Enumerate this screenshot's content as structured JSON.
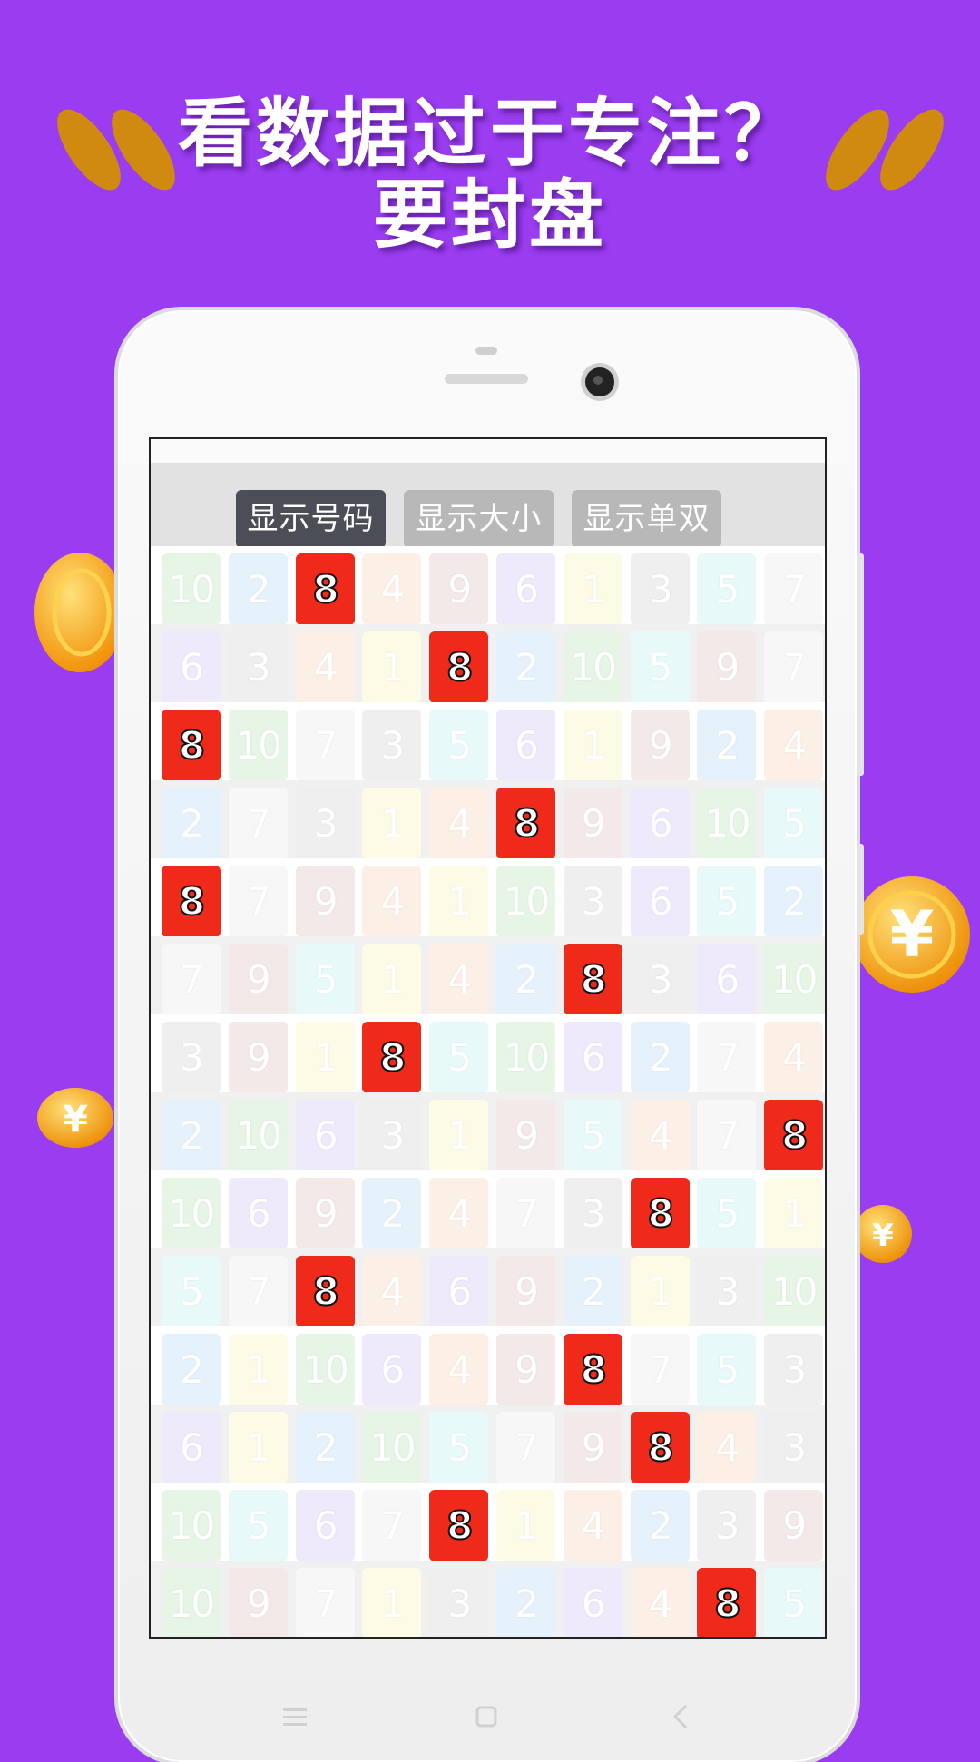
{
  "headline": {
    "line1": "看数据过于专注？",
    "line2": "要封盘"
  },
  "toolbar": {
    "buttons": [
      {
        "label": "显示号码",
        "active": true
      },
      {
        "label": "显示大小",
        "active": false
      },
      {
        "label": "显示单双",
        "active": false
      }
    ]
  },
  "grid": {
    "highlight_number": "8",
    "rows": [
      [
        "10",
        "2",
        "8",
        "4",
        "9",
        "6",
        "1",
        "3",
        "5",
        "7"
      ],
      [
        "6",
        "3",
        "4",
        "1",
        "8",
        "2",
        "10",
        "5",
        "9",
        "7"
      ],
      [
        "8",
        "10",
        "7",
        "3",
        "5",
        "6",
        "1",
        "9",
        "2",
        "4"
      ],
      [
        "2",
        "7",
        "3",
        "1",
        "4",
        "8",
        "9",
        "6",
        "10",
        "5"
      ],
      [
        "8",
        "7",
        "9",
        "4",
        "1",
        "10",
        "3",
        "6",
        "5",
        "2"
      ],
      [
        "7",
        "9",
        "5",
        "1",
        "4",
        "2",
        "8",
        "3",
        "6",
        "10"
      ],
      [
        "3",
        "9",
        "1",
        "8",
        "5",
        "10",
        "6",
        "2",
        "7",
        "4"
      ],
      [
        "2",
        "10",
        "6",
        "3",
        "1",
        "9",
        "5",
        "4",
        "7",
        "8"
      ],
      [
        "10",
        "6",
        "9",
        "2",
        "4",
        "7",
        "3",
        "8",
        "5",
        "1"
      ],
      [
        "5",
        "7",
        "8",
        "4",
        "6",
        "9",
        "2",
        "1",
        "3",
        "10"
      ],
      [
        "2",
        "1",
        "10",
        "6",
        "4",
        "9",
        "8",
        "7",
        "5",
        "3"
      ],
      [
        "6",
        "1",
        "2",
        "10",
        "5",
        "7",
        "9",
        "8",
        "4",
        "3"
      ],
      [
        "10",
        "5",
        "6",
        "7",
        "8",
        "1",
        "4",
        "2",
        "3",
        "9"
      ],
      [
        "10",
        "9",
        "7",
        "1",
        "3",
        "2",
        "6",
        "4",
        "8",
        "5"
      ]
    ],
    "number_colors": {
      "1": "#fbfbe6",
      "2": "#e6f2fb",
      "3": "#efefef",
      "4": "#fcefe6",
      "5": "#e8f9fa",
      "6": "#eee9fb",
      "7": "#f7f7f7",
      "8": "#f02a1a",
      "9": "#f3e9e9",
      "10": "#e6f5e6"
    }
  },
  "colors": {
    "background": "#9a3cf0",
    "active_button": "#4b4d57",
    "inactive_button": "#b8b8b8",
    "highlight": "#f02a1a"
  }
}
